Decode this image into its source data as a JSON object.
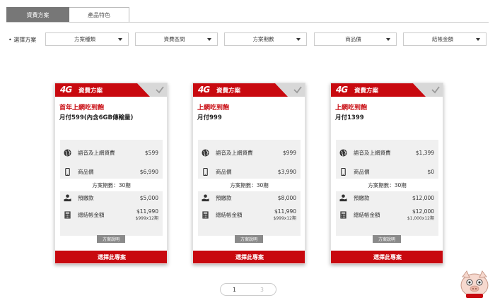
{
  "tabs": [
    {
      "label": "資費方案",
      "active": true
    },
    {
      "label": "產品特色",
      "active": false
    }
  ],
  "filter": {
    "label": "選擇方案",
    "dropdowns": [
      "方案種類",
      "資費區間",
      "方案期數",
      "商品價",
      "結帳金額"
    ]
  },
  "logo_text": "4G",
  "cards": [
    {
      "header": "資費方案",
      "title": "首年上網吃到飽",
      "subtitle": "月付599(內含6GB傳輸量)",
      "voice_label": "語音及上網資費",
      "voice_value": "$599",
      "device_label": "商品價",
      "device_value": "$6,990",
      "period": "方案期數：30期",
      "prepay_label": "預繳款",
      "prepay_value": "$5,000",
      "total_label": "總結帳金額",
      "total_value": "$11,990",
      "total_note": "$999x12期",
      "plan_button": "方案說明",
      "select_button": "選擇此專案"
    },
    {
      "header": "資費方案",
      "title": "上網吃到飽",
      "subtitle": "月付999",
      "voice_label": "語音及上網資費",
      "voice_value": "$999",
      "device_label": "商品價",
      "device_value": "$3,990",
      "period": "方案期數：30期",
      "prepay_label": "預繳款",
      "prepay_value": "$8,000",
      "total_label": "總結帳金額",
      "total_value": "$11,990",
      "total_note": "$999x12期",
      "plan_button": "方案說明",
      "select_button": "選擇此專案"
    },
    {
      "header": "資費方案",
      "title": "上網吃到飽",
      "subtitle": "月付1399",
      "voice_label": "語音及上網資費",
      "voice_value": "$1,399",
      "device_label": "商品價",
      "device_value": "$0",
      "period": "方案期數：30期",
      "prepay_label": "預繳款",
      "prepay_value": "$12,000",
      "total_label": "總結帳金額",
      "total_value": "$12,000",
      "total_note": "$1,000x12期",
      "plan_button": "方案說明",
      "select_button": "選擇此專案"
    }
  ],
  "pagination": {
    "current": "1",
    "other": "3"
  },
  "colors": {
    "brand_red": "#c8090f",
    "tab_active": "#777777",
    "info_bg": "#f0f0f0",
    "button_gray": "#8a8a8a"
  }
}
